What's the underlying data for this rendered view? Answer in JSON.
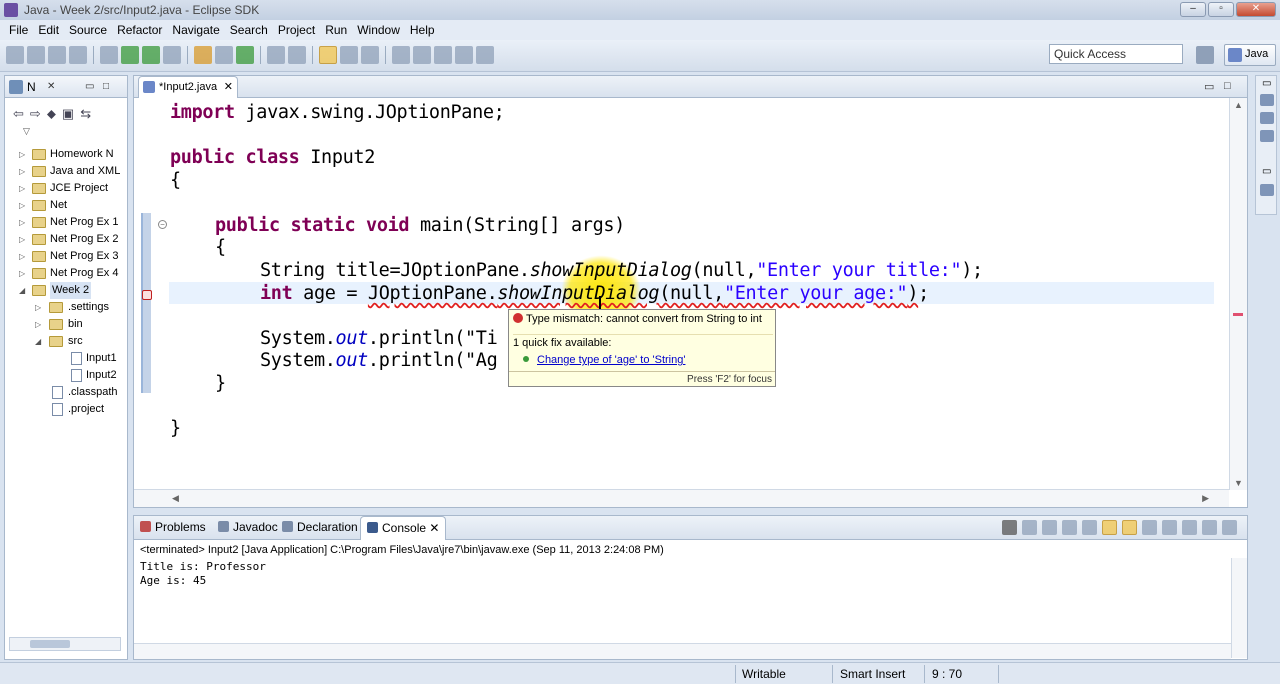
{
  "window": {
    "title": "Java - Week 2/src/Input2.java - Eclipse SDK",
    "minimize": "–",
    "maximize": "▫",
    "close": "✕"
  },
  "menu": [
    "File",
    "Edit",
    "Source",
    "Refactor",
    "Navigate",
    "Search",
    "Project",
    "Run",
    "Window",
    "Help"
  ],
  "toolbar": {
    "quick_access_placeholder": "Quick Access",
    "perspective": "Java"
  },
  "navigator": {
    "tab_label": "N",
    "items": [
      {
        "label": "Homework N",
        "expanded": false
      },
      {
        "label": "Java and XML",
        "expanded": false
      },
      {
        "label": "JCE Project",
        "expanded": false
      },
      {
        "label": "Net",
        "expanded": false
      },
      {
        "label": "Net Prog Ex 1",
        "expanded": false
      },
      {
        "label": "Net Prog Ex 2",
        "expanded": false
      },
      {
        "label": "Net Prog Ex 3",
        "expanded": false
      },
      {
        "label": "Net Prog Ex 4",
        "expanded": false
      },
      {
        "label": "Week 2",
        "expanded": true
      },
      {
        "label": ".settings",
        "expanded": false
      },
      {
        "label": "bin",
        "expanded": false
      },
      {
        "label": "src",
        "expanded": true
      },
      {
        "label": "Input1",
        "expanded": false
      },
      {
        "label": "Input2",
        "expanded": false
      },
      {
        "label": ".classpath",
        "expanded": false
      },
      {
        "label": ".project",
        "expanded": false
      }
    ]
  },
  "editor": {
    "tab_label": "*Input2.java",
    "code": {
      "l1_kw": "import",
      "l1_rest": " javax.swing.JOptionPane;",
      "l2_kw1": "public",
      "l2_kw2": "class",
      "l2_rest": " Input2",
      "l3": "{",
      "l4_kw": "public static void",
      "l4_rest": " main(String[] args)",
      "l5": "{",
      "l6_a": "String title=JOptionPane.",
      "l6_m": "showInputDialog",
      "l6_b": "(null,",
      "l6_s": "\"Enter your title:\"",
      "l6_c": ");",
      "l7_kw": "int",
      "l7_a": " age = ",
      "l7_err_a": "JOptionPane.",
      "l7_err_m": "showInputDialog",
      "l7_err_b": "(null,",
      "l7_err_s": "\"Enter your age:\"",
      "l7_err_c": ")",
      "l7_end": ";",
      "l8_a": "System.",
      "l8_f": "out",
      "l8_b": ".println(\"Ti",
      "l9_a": "System.",
      "l9_f": "out",
      "l9_b": ".println(\"Ag",
      "l10": "}",
      "l11": "}"
    },
    "hover": {
      "error": "Type mismatch: cannot convert from String to int",
      "quick_fix_count": "1 quick fix available:",
      "quick_fix": "Change type of 'age' to 'String'",
      "focus_hint": "Press 'F2' for focus"
    }
  },
  "console": {
    "tabs": [
      "Problems",
      "Javadoc",
      "Declaration",
      "Console"
    ],
    "active_tab": "Console",
    "terminated": "<terminated> Input2 [Java Application] C:\\Program Files\\Java\\jre7\\bin\\javaw.exe (Sep 11, 2013 2:24:08 PM)",
    "output": [
      "Title is: Professor",
      "Age is: 45"
    ]
  },
  "status": {
    "writable": "Writable",
    "insert_mode": "Smart Insert",
    "position": "9 : 70"
  }
}
